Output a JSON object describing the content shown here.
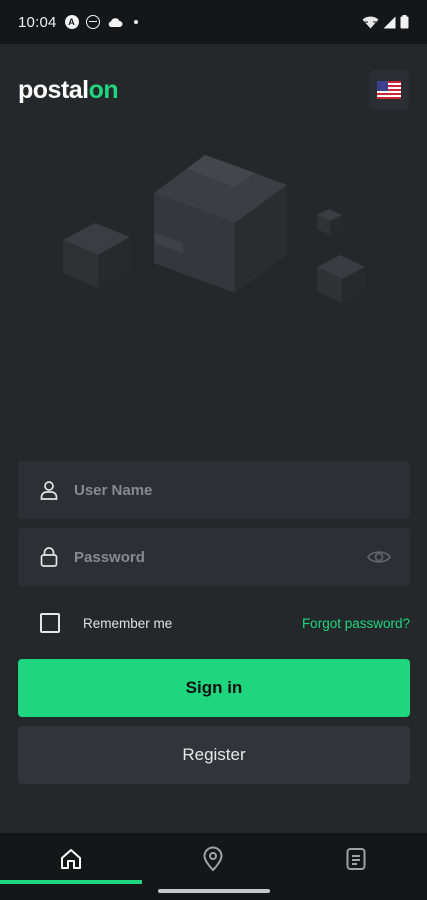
{
  "status_bar": {
    "time": "10:04",
    "left_icons": [
      "a-circle-icon",
      "do-not-disturb-icon",
      "cloud-icon",
      "notification-dot"
    ],
    "right_icons": [
      "wifi-icon",
      "signal-icon",
      "battery-icon"
    ],
    "a_icon_letter": "A"
  },
  "header": {
    "logo_main": "postal",
    "logo_accent": "on",
    "language_icon": "us-flag-icon"
  },
  "form": {
    "username_placeholder": "User Name",
    "username_value": "",
    "password_placeholder": "Password",
    "password_value": "",
    "remember_label": "Remember me",
    "remember_checked": false,
    "forgot_label": "Forgot password?",
    "signin_label": "Sign in",
    "register_label": "Register"
  },
  "bottom_nav": {
    "items": [
      {
        "icon": "home-icon",
        "active": true
      },
      {
        "icon": "location-pin-icon",
        "active": false
      },
      {
        "icon": "document-icon",
        "active": false
      }
    ]
  },
  "colors": {
    "accent": "#1ed67d",
    "background": "#25282b",
    "field": "#2c2f33",
    "nav": "#141618"
  }
}
